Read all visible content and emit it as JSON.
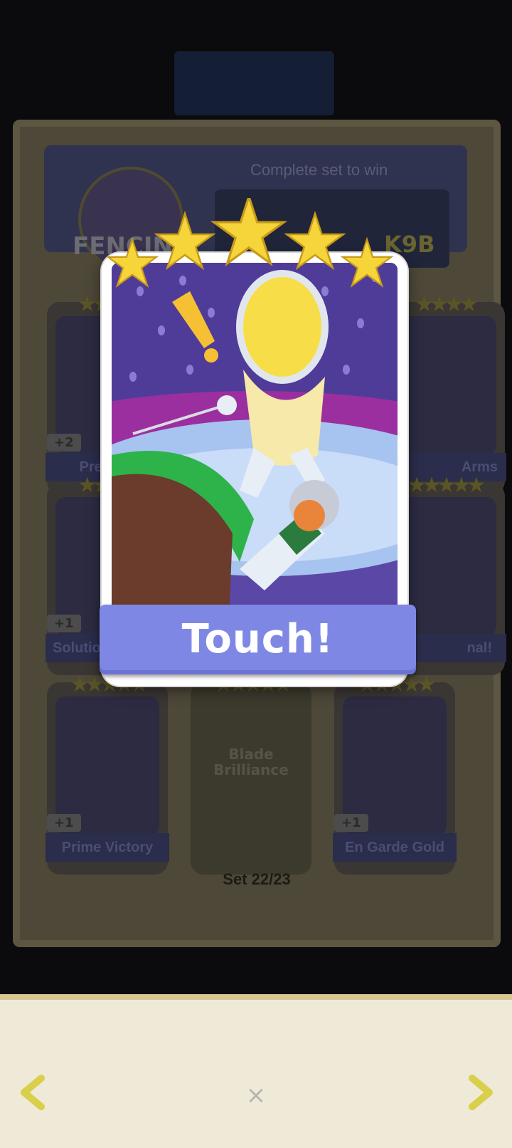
{
  "album": {
    "header": {
      "set_name": "FENCING",
      "complete_text": "Complete set to win",
      "prize_text": "K9B"
    },
    "cards": [
      {
        "name": "Prestige",
        "badge": "+2",
        "stars": "★★★★"
      },
      {
        "name": "Arms",
        "badge": "",
        "stars": "★★★★"
      },
      {
        "name": "Solution",
        "badge": "+1",
        "stars": "★★★★"
      },
      {
        "name": "nal!",
        "badge": "",
        "stars": "★★★★★"
      },
      {
        "name": "Prime Victory",
        "badge": "+1",
        "stars": "★★★★★"
      },
      {
        "name": "Blade Brilliance",
        "badge": "",
        "stars": "★★★★★"
      },
      {
        "name": "En Garde Gold",
        "badge": "+1",
        "stars": "★★★★★"
      }
    ],
    "set_progress": "Set 22/23"
  },
  "focus_card": {
    "title": "Touch!",
    "stars": 5,
    "star_color": "#f5d53a",
    "label_color": "#7e88e4"
  },
  "controls": {
    "prev_icon": "chevron-left-icon",
    "next_icon": "chevron-right-icon",
    "close_label": "×"
  }
}
